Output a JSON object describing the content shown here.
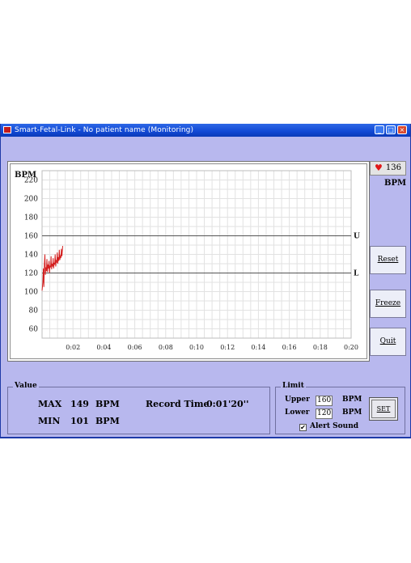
{
  "window": {
    "title": "Smart-Fetal-Link - No patient name (Monitoring)",
    "buttons": {
      "minimize": "_",
      "maximize": "□",
      "close": "×"
    }
  },
  "heart_rate": {
    "icon": "heart-icon",
    "value": "136",
    "unit": "BPM"
  },
  "side_buttons": {
    "reset": "Reset",
    "freeze": "Freeze",
    "quit": "Quit"
  },
  "chart_data": {
    "type": "line",
    "ylabel": "BPM",
    "ylim": [
      50,
      230
    ],
    "y_ticks": [
      "60",
      "80",
      "100",
      "120",
      "140",
      "160",
      "180",
      "200",
      "220"
    ],
    "x_ticks": [
      "0:02",
      "0:04",
      "0:06",
      "0:08",
      "0:10",
      "0:12",
      "0:14",
      "0:16",
      "0:18",
      "0:20"
    ],
    "xlim_seconds": [
      0,
      1200
    ],
    "upper_line": {
      "value": 160,
      "label": "U"
    },
    "lower_line": {
      "value": 120,
      "label": "L"
    },
    "grid": true,
    "series_color": "#d42020",
    "series": [
      {
        "x": [
          0,
          3,
          5,
          7,
          9,
          11,
          13,
          15,
          17,
          19,
          21,
          23,
          25,
          27,
          29,
          31,
          33,
          35,
          37,
          39,
          41,
          43,
          45,
          47,
          49,
          51,
          53,
          55,
          57,
          59,
          61,
          63,
          65,
          67,
          69,
          71,
          73,
          75,
          77,
          80
        ],
        "y": [
          101,
          110,
          125,
          105,
          130,
          140,
          118,
          126,
          122,
          135,
          121,
          129,
          125,
          133,
          120,
          128,
          126,
          138,
          124,
          130,
          127,
          136,
          125,
          131,
          129,
          140,
          127,
          134,
          131,
          142,
          130,
          137,
          133,
          145,
          134,
          139,
          136,
          146,
          138,
          149
        ]
      }
    ]
  },
  "value_group": {
    "title": "Value",
    "max_label": "MAX",
    "max_value": "149",
    "max_unit": "BPM",
    "min_label": "MIN",
    "min_value": "101",
    "min_unit": "BPM",
    "record_label": "Record Time",
    "record_value": "0:01'20''"
  },
  "limit_group": {
    "title": "Limit",
    "upper_label": "Upper",
    "upper_value": "160",
    "upper_unit": "BPM",
    "lower_label": "Lower",
    "lower_value": "120",
    "lower_unit": "BPM",
    "set_button": "SET",
    "alert_sound_label": "Alert Sound",
    "alert_sound_checked": "✔"
  }
}
